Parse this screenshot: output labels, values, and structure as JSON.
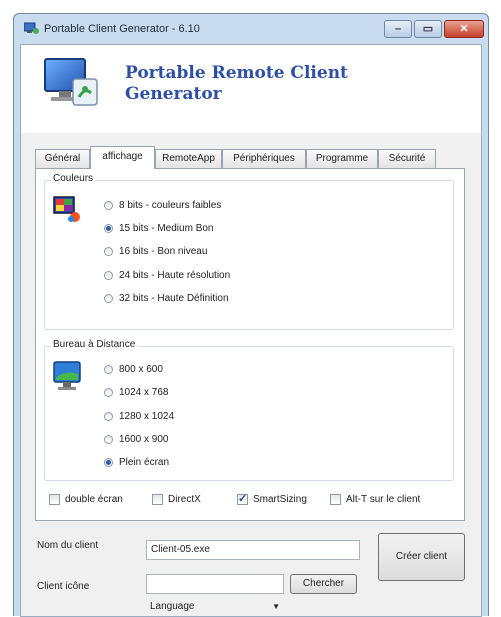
{
  "window": {
    "title": "Portable Client Generator - 6.10"
  },
  "header": {
    "title_line1": "Portable Remote Client",
    "title_line2": "Generator"
  },
  "tabs": [
    {
      "label": "Général",
      "active": false
    },
    {
      "label": "affichage",
      "active": true
    },
    {
      "label": "RemoteApp",
      "active": false
    },
    {
      "label": "Périphériques",
      "active": false
    },
    {
      "label": "Programme",
      "active": false
    },
    {
      "label": "Sécurité",
      "active": false
    }
  ],
  "couleurs": {
    "title": "Couleurs",
    "options": [
      {
        "label": "8 bits - couleurs faibles",
        "selected": false
      },
      {
        "label": "15 bits - Medium Bon",
        "selected": true
      },
      {
        "label": "16 bits - Bon niveau",
        "selected": false
      },
      {
        "label": "24 bits - Haute résolution",
        "selected": false
      },
      {
        "label": "32 bits - Haute Définition",
        "selected": false
      }
    ]
  },
  "bureau": {
    "title": "Bureau à Distance",
    "options": [
      {
        "label": "800 x 600",
        "selected": false
      },
      {
        "label": "1024 x 768",
        "selected": false
      },
      {
        "label": "1280 x 1024",
        "selected": false
      },
      {
        "label": "1600 x 900",
        "selected": false
      },
      {
        "label": "Plein écran",
        "selected": true
      }
    ]
  },
  "checkboxes": [
    {
      "label": "double écran",
      "checked": false
    },
    {
      "label": "DirectX",
      "checked": false
    },
    {
      "label": "SmartSizing",
      "checked": true
    },
    {
      "label": "Alt-T sur le client",
      "checked": false
    }
  ],
  "form": {
    "client_name_label": "Nom du client",
    "client_name_value": "Client-05.exe",
    "client_icon_label": "Client icône",
    "client_icon_value": "",
    "browse_button": "Chercher",
    "create_button": "Créer client",
    "language_value": "Language"
  },
  "colors": {
    "accent": "#2e4fa8",
    "frame": "#c9dcef",
    "close": "#c7402b"
  }
}
